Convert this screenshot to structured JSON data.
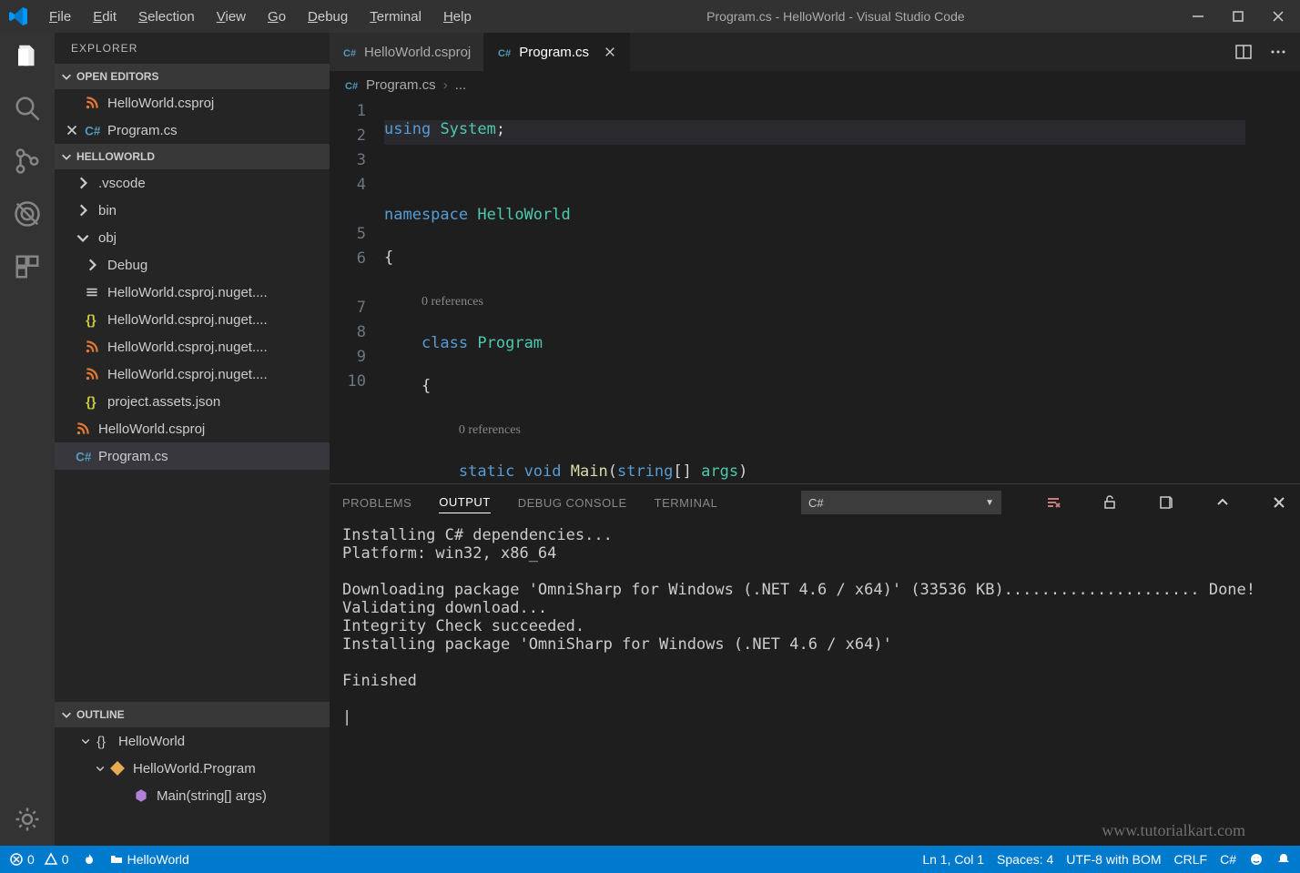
{
  "title_bar": {
    "title": "Program.cs - HelloWorld - Visual Studio Code",
    "menu": [
      "File",
      "Edit",
      "Selection",
      "View",
      "Go",
      "Debug",
      "Terminal",
      "Help"
    ]
  },
  "sidebar": {
    "title": "EXPLORER",
    "open_editors_header": "OPEN EDITORS",
    "open_editors": [
      {
        "icon": "rss",
        "label": "HelloWorld.csproj",
        "modified": false
      },
      {
        "icon": "csharp",
        "label": "Program.cs",
        "modified": true
      }
    ],
    "project_header": "HELLOWORLD",
    "tree": [
      {
        "icon": "chev-right",
        "label": ".vscode",
        "indent": 0
      },
      {
        "icon": "chev-right",
        "label": "bin",
        "indent": 0
      },
      {
        "icon": "chev-down",
        "label": "obj",
        "indent": 0
      },
      {
        "icon": "chev-right",
        "label": "Debug",
        "indent": 1
      },
      {
        "icon": "cache",
        "label": "HelloWorld.csproj.nuget....",
        "indent": 1
      },
      {
        "icon": "json",
        "label": "HelloWorld.csproj.nuget....",
        "indent": 1
      },
      {
        "icon": "rss",
        "label": "HelloWorld.csproj.nuget....",
        "indent": 1
      },
      {
        "icon": "rss",
        "label": "HelloWorld.csproj.nuget....",
        "indent": 1
      },
      {
        "icon": "json",
        "label": "project.assets.json",
        "indent": 1
      },
      {
        "icon": "rss",
        "label": "HelloWorld.csproj",
        "indent": 0
      },
      {
        "icon": "csharp",
        "label": "Program.cs",
        "indent": 0,
        "selected": true
      }
    ],
    "outline_header": "OUTLINE",
    "outline": [
      {
        "level": 0,
        "icon": "braces",
        "label": "HelloWorld"
      },
      {
        "level": 1,
        "icon": "class",
        "label": "HelloWorld.Program"
      },
      {
        "level": 2,
        "icon": "method",
        "label": "Main(string[] args)"
      }
    ]
  },
  "tabs": [
    {
      "icon": "csharp",
      "label": "HelloWorld.csproj",
      "active": false
    },
    {
      "icon": "csharp",
      "label": "Program.cs",
      "active": true
    }
  ],
  "breadcrumbs": {
    "file": "Program.cs",
    "more": "..."
  },
  "code": {
    "references_text_1": "0 references",
    "references_text_2": "0 references",
    "line_numbers": [
      "1",
      "2",
      "3",
      "4",
      "",
      "5",
      "6",
      "",
      "7",
      "8",
      "9",
      "10"
    ]
  },
  "panel": {
    "tabs": [
      "PROBLEMS",
      "OUTPUT",
      "DEBUG CONSOLE",
      "TERMINAL"
    ],
    "active_tab": "OUTPUT",
    "selector": "C#",
    "output": "Installing C# dependencies...\nPlatform: win32, x86_64\n\nDownloading package 'OmniSharp for Windows (.NET 4.6 / x64)' (33536 KB)..................... Done!\nValidating download...\nIntegrity Check succeeded.\nInstalling package 'OmniSharp for Windows (.NET 4.6 / x64)'\n\nFinished\n\n|"
  },
  "status": {
    "errors": "0",
    "warnings": "0",
    "folder": "HelloWorld",
    "ln_col": "Ln 1, Col 1",
    "spaces": "Spaces: 4",
    "encoding": "UTF-8 with BOM",
    "eol": "CRLF",
    "lang": "C#"
  },
  "watermark": "www.tutorialkart.com"
}
